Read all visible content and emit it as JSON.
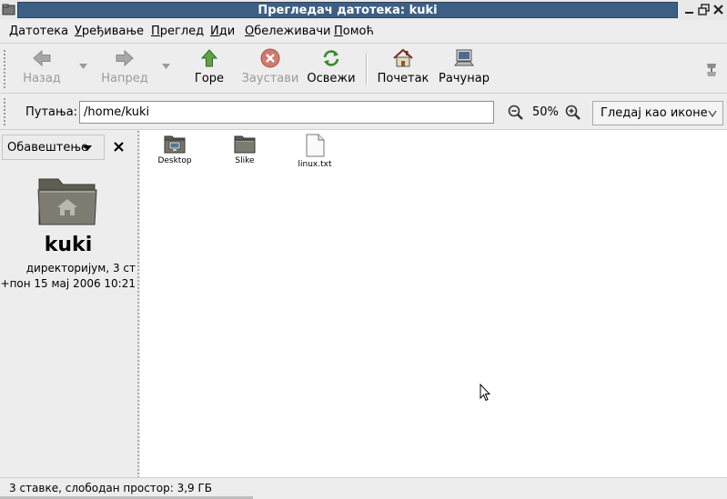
{
  "window": {
    "title": "Прегледач датотека: kuki",
    "icons": {
      "app": "file-manager-icon",
      "minimize": "minimize-icon",
      "maximize": "maximize-icon",
      "close": "close-icon"
    }
  },
  "menu": {
    "items": [
      {
        "mnemonic": "Д",
        "rest": "атотека"
      },
      {
        "mnemonic": "У",
        "rest": "ређивање"
      },
      {
        "mnemonic": "П",
        "rest": "реглед"
      },
      {
        "mnemonic": "И",
        "rest": "ди"
      },
      {
        "mnemonic": "О",
        "rest": "бележивачи"
      },
      {
        "mnemonic": "П",
        "rest": "омоћ"
      }
    ]
  },
  "toolbar": {
    "back": {
      "label": "Назад",
      "enabled": false
    },
    "forward": {
      "label": "Напред",
      "enabled": false
    },
    "up": {
      "label": "Горе",
      "enabled": true
    },
    "stop": {
      "label": "Заустави",
      "enabled": false
    },
    "reload": {
      "label": "Освежи",
      "enabled": true
    },
    "home": {
      "label": "Почетак",
      "enabled": true
    },
    "computer": {
      "label": "Рачунар",
      "enabled": true
    }
  },
  "location": {
    "label": "Путања:",
    "path": "/home/kuki",
    "zoom": "50%",
    "view_mode": "Гледај као иконе"
  },
  "sidepane": {
    "header": "Обавештење",
    "folder_name": "kuki",
    "info_line1": "директоријум, 3 ст",
    "info_line2": "+пон 15 мај 2006 10:21"
  },
  "files": [
    {
      "name": "Desktop",
      "icon": "desktop-folder-icon"
    },
    {
      "name": "Slike",
      "icon": "folder-icon"
    },
    {
      "name": "linux.txt",
      "icon": "text-file-icon"
    }
  ],
  "status": {
    "text": "3 ставке, слободан простор: 3,9 ГБ"
  },
  "colors": {
    "title_bar": "#3d5f83",
    "chrome": "#ededed",
    "folder": "#6d6d60"
  }
}
